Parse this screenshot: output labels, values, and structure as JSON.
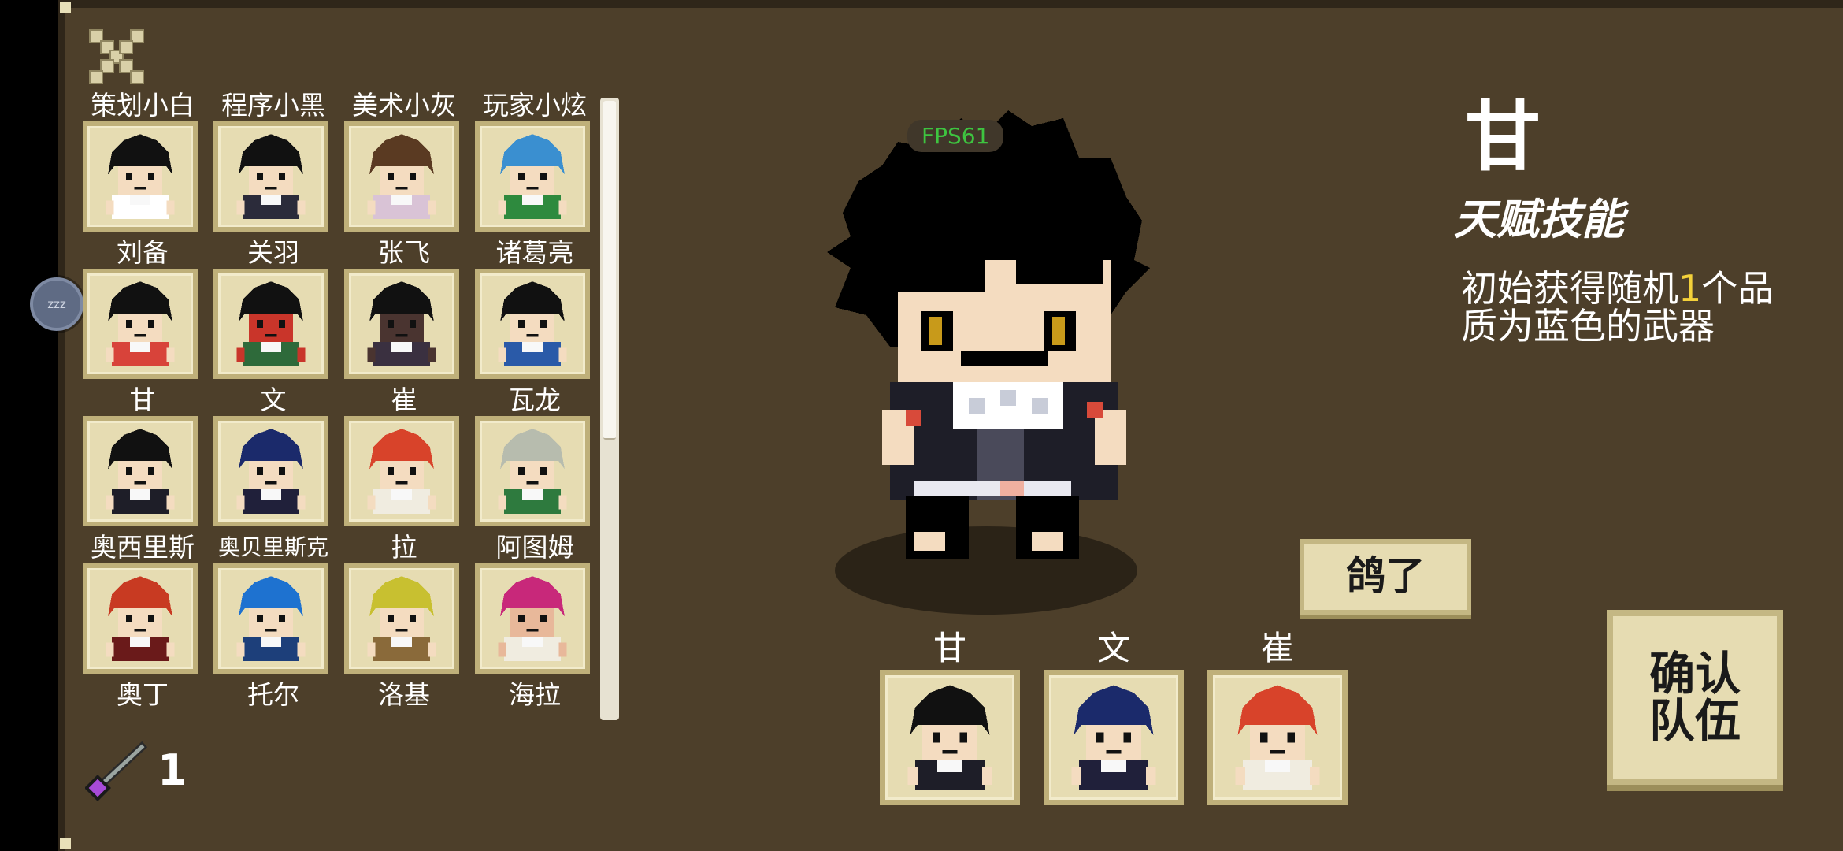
{
  "fps_text": "FPS61",
  "side_badge": "zzz",
  "roster": [
    {
      "name": "策划小白",
      "hair": "#111111",
      "skin": "#f4dcc0",
      "shirt": "#ffffff"
    },
    {
      "name": "程序小黑",
      "hair": "#111111",
      "skin": "#f4dcc0",
      "shirt": "#2b2b3a"
    },
    {
      "name": "美术小灰",
      "hair": "#5a3a22",
      "skin": "#f4dcc0",
      "shirt": "#d9c3d6"
    },
    {
      "name": "玩家小炫",
      "hair": "#3a8fd0",
      "skin": "#f4dcc0",
      "shirt": "#2e8a3e"
    },
    {
      "name": "刘备",
      "hair": "#111111",
      "skin": "#f4dcc0",
      "shirt": "#d8433a"
    },
    {
      "name": "关羽",
      "hair": "#111111",
      "skin": "#c9352a",
      "shirt": "#2e6a3a"
    },
    {
      "name": "张飞",
      "hair": "#111111",
      "skin": "#4a3430",
      "shirt": "#3a3040"
    },
    {
      "name": "诸葛亮",
      "hair": "#111111",
      "skin": "#f4dcc0",
      "shirt": "#2a5aa8"
    },
    {
      "name": "甘",
      "hair": "#111111",
      "skin": "#f4dcc0",
      "shirt": "#1e1e28"
    },
    {
      "name": "文",
      "hair": "#1b2a6b",
      "skin": "#f4dcc0",
      "shirt": "#20203a"
    },
    {
      "name": "崔",
      "hair": "#d8432a",
      "skin": "#f4dcc0",
      "shirt": "#f0ece0"
    },
    {
      "name": "瓦龙",
      "hair": "#b7bcae",
      "skin": "#f4dcc0",
      "shirt": "#2e7a3e"
    },
    {
      "name": "奥西里斯",
      "hair": "#c83a22",
      "skin": "#f4dcc0",
      "shirt": "#6a1a1a"
    },
    {
      "name": "奥贝里斯克",
      "hair": "#1e72d0",
      "skin": "#f4dcc0",
      "shirt": "#1d3f7a"
    },
    {
      "name": "拉",
      "hair": "#c8c030",
      "skin": "#f4dcc0",
      "shirt": "#8a6a3a"
    },
    {
      "name": "阿图姆",
      "hair": "#c8287a",
      "skin": "#e8b89a",
      "shirt": "#f0ece0"
    },
    {
      "name": "奥丁",
      "hair": null,
      "skin": null,
      "shirt": null
    },
    {
      "name": "托尔",
      "hair": null,
      "skin": null,
      "shirt": null
    },
    {
      "name": "洛基",
      "hair": null,
      "skin": null,
      "shirt": null
    },
    {
      "name": "海拉",
      "hair": null,
      "skin": null,
      "shirt": null
    }
  ],
  "wand_count": "1",
  "selected": {
    "name": "甘",
    "talent_title": "天赋技能",
    "talent_desc_pre": "初始获得随机",
    "talent_desc_num": "1",
    "talent_desc_post": "个品质为蓝色的武器"
  },
  "gaole_button": "鸽了",
  "confirm_button": "确认队伍",
  "team": [
    {
      "name": "甘",
      "hair": "#111111",
      "skin": "#f4dcc0",
      "shirt": "#1e1e28"
    },
    {
      "name": "文",
      "hair": "#1b2a6b",
      "skin": "#f4dcc0",
      "shirt": "#20203a"
    },
    {
      "name": "崔",
      "hair": "#d8432a",
      "skin": "#f4dcc0",
      "shirt": "#f0ece0"
    }
  ],
  "colors": {
    "panel_bg": "#4d3f2a",
    "card_bg": "#e6dcb2",
    "card_border": "#bfb07a",
    "highlight_yellow": "#f4d13a",
    "fps_green": "#3ec440"
  }
}
